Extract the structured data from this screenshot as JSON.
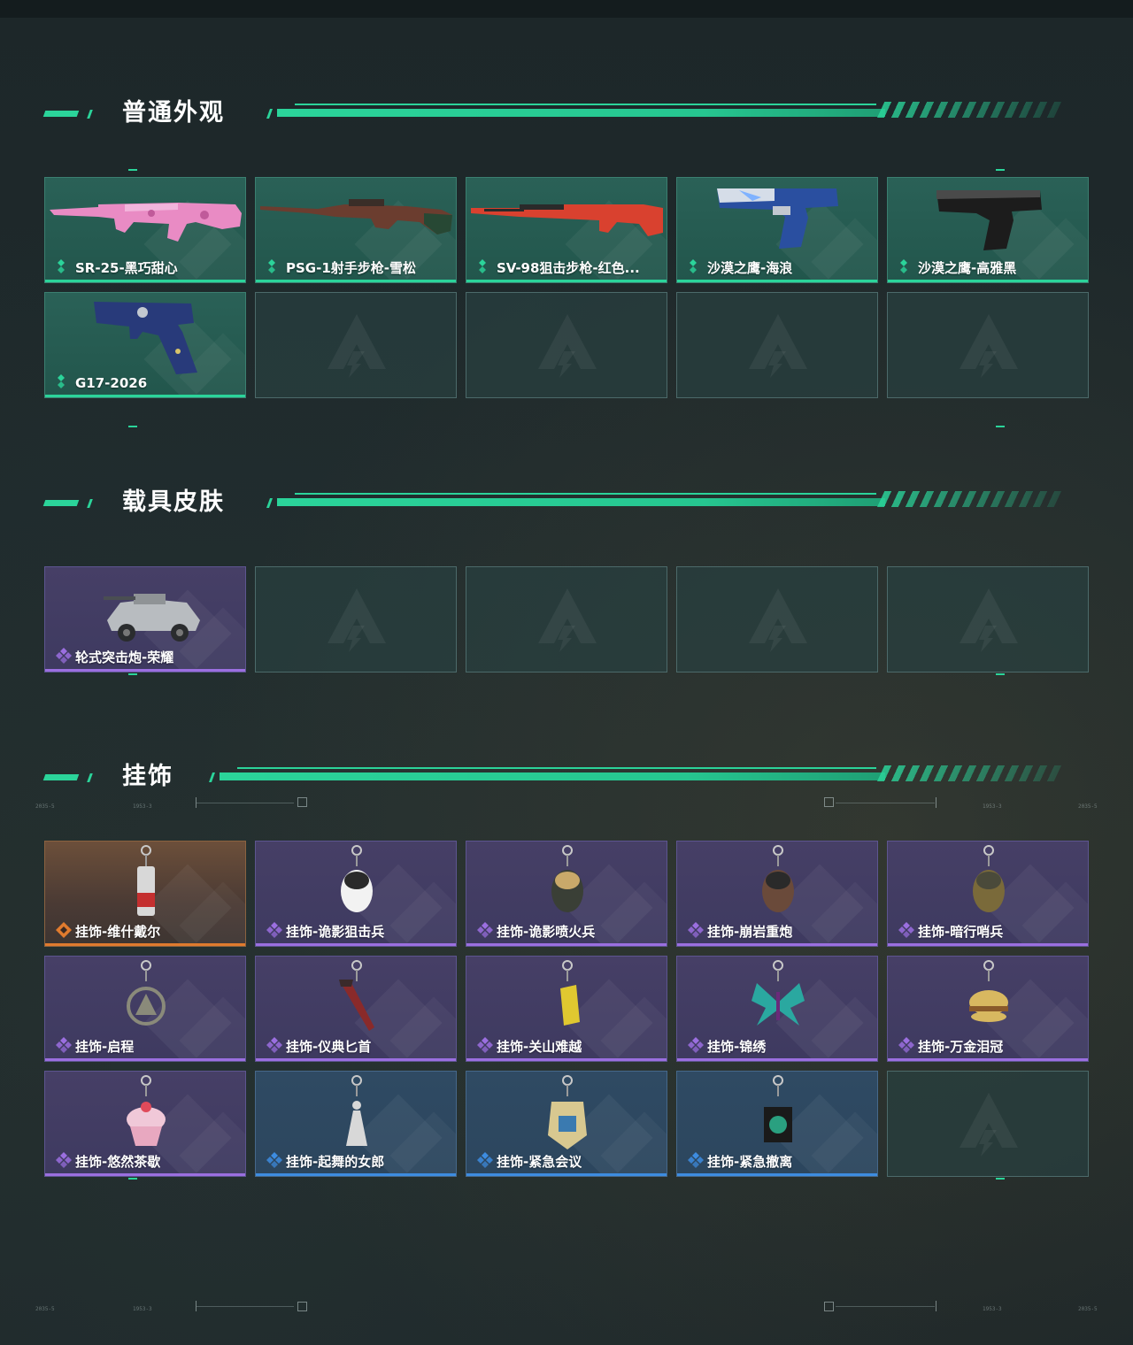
{
  "sections": [
    {
      "title": "普通外观",
      "items": [
        {
          "label": "SR-25-黑巧甜心",
          "rarity": "green",
          "icon": "rifle-pink-icon"
        },
        {
          "label": "PSG-1射手步枪-雪松",
          "rarity": "green",
          "icon": "sniper-rifle-icon"
        },
        {
          "label": "SV-98狙击步枪-红色...",
          "rarity": "green",
          "icon": "sniper-rifle-red-icon"
        },
        {
          "label": "沙漠之鹰-海浪",
          "rarity": "green",
          "icon": "pistol-blue-icon"
        },
        {
          "label": "沙漠之鹰-高雅黑",
          "rarity": "green",
          "icon": "pistol-black-icon"
        },
        {
          "label": "G17-2026",
          "rarity": "green",
          "icon": "pistol-navy-icon"
        }
      ]
    },
    {
      "title": "载具皮肤",
      "items": [
        {
          "label": "轮式突击炮-荣耀",
          "rarity": "purple",
          "icon": "armored-vehicle-icon"
        }
      ]
    },
    {
      "title": "挂饰",
      "items": [
        {
          "label": "挂饰-维什戴尔",
          "rarity": "orange",
          "icon": "charm-keychain-icon"
        },
        {
          "label": "挂饰-诡影狙击兵",
          "rarity": "purple",
          "icon": "charm-goose-icon"
        },
        {
          "label": "挂饰-诡影喷火兵",
          "rarity": "purple",
          "icon": "charm-soldier-icon"
        },
        {
          "label": "挂饰-崩岩重炮",
          "rarity": "purple",
          "icon": "charm-figure-icon"
        },
        {
          "label": "挂饰-暗行哨兵",
          "rarity": "purple",
          "icon": "charm-helmet-icon"
        },
        {
          "label": "挂饰-启程",
          "rarity": "purple",
          "icon": "charm-emblem-icon"
        },
        {
          "label": "挂饰-仪典匕首",
          "rarity": "purple",
          "icon": "charm-dagger-icon"
        },
        {
          "label": "挂饰-关山难越",
          "rarity": "purple",
          "icon": "charm-battery-icon"
        },
        {
          "label": "挂饰-锦绣",
          "rarity": "purple",
          "icon": "charm-butterfly-icon"
        },
        {
          "label": "挂饰-万金泪冠",
          "rarity": "purple",
          "icon": "charm-burger-icon"
        },
        {
          "label": "挂饰-悠然茶歇",
          "rarity": "purple",
          "icon": "charm-cupcake-icon"
        },
        {
          "label": "挂饰-起舞的女郎",
          "rarity": "blue",
          "icon": "charm-dancer-icon"
        },
        {
          "label": "挂饰-紧急会议",
          "rarity": "blue",
          "icon": "charm-badge-icon"
        },
        {
          "label": "挂饰-紧急撤离",
          "rarity": "blue",
          "icon": "charm-cube-icon"
        }
      ]
    }
  ],
  "hud": {
    "tag_a": "2035-5",
    "tag_b": "1953-3"
  },
  "colors": {
    "accent": "#2bd49a",
    "purple": "#9b6fe0",
    "blue": "#3d8ce0",
    "orange": "#e07b2e"
  }
}
